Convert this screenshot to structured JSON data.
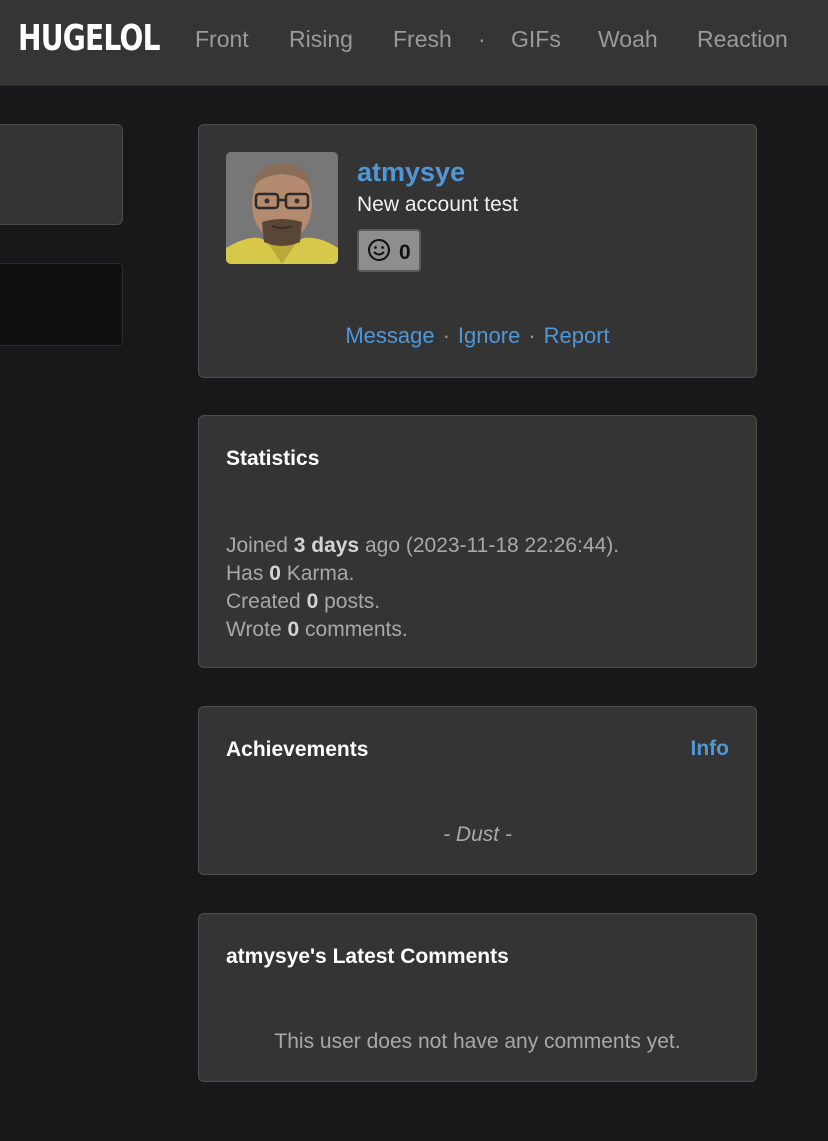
{
  "header": {
    "logo": "HUGELOL",
    "nav": [
      "Front",
      "Rising",
      "Fresh",
      "·",
      "GIFs",
      "Woah",
      "Reaction"
    ]
  },
  "profile": {
    "username": "atmysye",
    "tagline": "New account test",
    "karma_badge": "0",
    "links": {
      "message": "Message",
      "sep1": "·",
      "ignore": "Ignore",
      "sep2": "·",
      "report": "Report"
    }
  },
  "statistics": {
    "title": "Statistics",
    "joined_prefix": "Joined",
    "joined_value": "3 days",
    "joined_suffix": "ago (2023-11-18 22:26:44).",
    "karma_prefix": "Has",
    "karma_value": "0",
    "karma_suffix": "Karma.",
    "posts_prefix": "Created",
    "posts_value": "0",
    "posts_suffix": "posts.",
    "comments_prefix": "Wrote",
    "comments_value": "0",
    "comments_suffix": "comments."
  },
  "achievements": {
    "title": "Achievements",
    "info_link": "Info",
    "rank": "- Dust -"
  },
  "latest_comments": {
    "title": "atmysye's Latest Comments",
    "empty_text": "This user does not have any comments yet."
  },
  "colors": {
    "accent_link": "#4f97d6",
    "background": "#18181a",
    "topbar": "#353535",
    "card": "#343434"
  }
}
